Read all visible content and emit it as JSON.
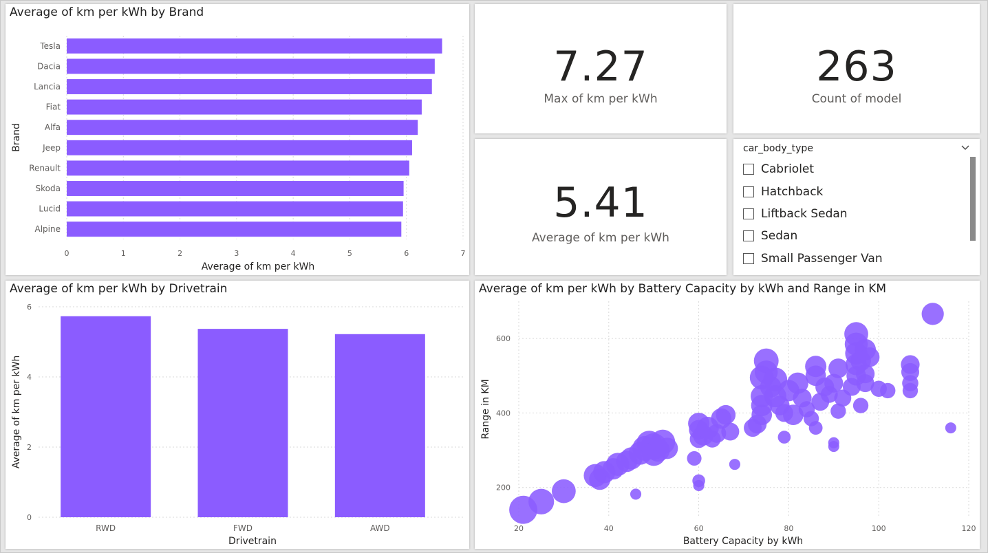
{
  "colors": {
    "bar": "#8b5cff",
    "bubble": "#8b5cff",
    "gridline": "#d9d9d9",
    "axis_text": "#605e5c"
  },
  "brand_chart": {
    "title": "Average of km per kWh by Brand",
    "chart_data": {
      "type": "bar",
      "orientation": "horizontal",
      "categories": [
        "Tesla",
        "Dacia",
        "Lancia",
        "Fiat",
        "Alfa",
        "Jeep",
        "Renault",
        "Skoda",
        "Lucid",
        "Alpine"
      ],
      "values": [
        6.63,
        6.5,
        6.45,
        6.27,
        6.2,
        6.1,
        6.05,
        5.95,
        5.94,
        5.91
      ],
      "xlabel": "Average of km per kWh",
      "ylabel": "Brand",
      "xlim": [
        0,
        7
      ],
      "xticks": [
        "0",
        "1",
        "2",
        "3",
        "4",
        "5",
        "6",
        "7"
      ],
      "grid": true
    }
  },
  "kpi_max": {
    "value": "7.27",
    "label": "Max of km per kWh"
  },
  "kpi_count": {
    "value": "263",
    "label": "Count of model"
  },
  "kpi_avg": {
    "value": "5.41",
    "label": "Average of km per kWh"
  },
  "slicer": {
    "title": "car_body_type",
    "items": [
      "Cabriolet",
      "Hatchback",
      "Liftback Sedan",
      "Sedan",
      "Small Passenger Van"
    ]
  },
  "drivetrain_chart": {
    "title": "Average of km per kWh by Drivetrain",
    "chart_data": {
      "type": "bar",
      "categories": [
        "RWD",
        "FWD",
        "AWD"
      ],
      "values": [
        5.73,
        5.37,
        5.22
      ],
      "xlabel": "Drivetrain",
      "ylabel": "Average of km per kWh",
      "ylim": [
        0,
        6
      ],
      "yticks": [
        "0",
        "2",
        "4",
        "6"
      ],
      "grid": true
    }
  },
  "scatter_chart": {
    "title": "Average of km per kWh by Battery Capacity by kWh and Range in KM",
    "chart_data": {
      "type": "scatter",
      "xlabel": "Battery Capacity by kWh",
      "ylabel": "Range in KM",
      "xlim": [
        20,
        120
      ],
      "ylim": [
        120,
        700
      ],
      "xticks": [
        "20",
        "40",
        "60",
        "80",
        "100",
        "120"
      ],
      "yticks": [
        "200",
        "400",
        "600"
      ],
      "grid": true,
      "points": [
        {
          "x": 21,
          "y": 140,
          "s": 6.8
        },
        {
          "x": 25,
          "y": 162,
          "s": 6.5
        },
        {
          "x": 30,
          "y": 190,
          "s": 6.3
        },
        {
          "x": 37,
          "y": 232,
          "s": 6.2
        },
        {
          "x": 38,
          "y": 222,
          "s": 6.0
        },
        {
          "x": 39,
          "y": 241,
          "s": 6.1
        },
        {
          "x": 41,
          "y": 250,
          "s": 6.0
        },
        {
          "x": 42,
          "y": 262,
          "s": 6.2
        },
        {
          "x": 44,
          "y": 270,
          "s": 6.0
        },
        {
          "x": 45,
          "y": 278,
          "s": 6.1
        },
        {
          "x": 46,
          "y": 182,
          "s": 4.8
        },
        {
          "x": 47,
          "y": 292,
          "s": 6.2
        },
        {
          "x": 48,
          "y": 305,
          "s": 6.4
        },
        {
          "x": 49,
          "y": 318,
          "s": 6.5
        },
        {
          "x": 50,
          "y": 310,
          "s": 6.6
        },
        {
          "x": 50,
          "y": 290,
          "s": 6.3
        },
        {
          "x": 51,
          "y": 300,
          "s": 6.2
        },
        {
          "x": 52,
          "y": 322,
          "s": 6.4
        },
        {
          "x": 53,
          "y": 305,
          "s": 6.0
        },
        {
          "x": 59,
          "y": 278,
          "s": 5.2
        },
        {
          "x": 60,
          "y": 218,
          "s": 5.0
        },
        {
          "x": 60,
          "y": 205,
          "s": 4.8
        },
        {
          "x": 60,
          "y": 330,
          "s": 5.6
        },
        {
          "x": 60,
          "y": 355,
          "s": 5.8
        },
        {
          "x": 60,
          "y": 372,
          "s": 6.0
        },
        {
          "x": 61,
          "y": 340,
          "s": 5.9
        },
        {
          "x": 62,
          "y": 360,
          "s": 6.1
        },
        {
          "x": 63,
          "y": 330,
          "s": 5.5
        },
        {
          "x": 64,
          "y": 345,
          "s": 5.7
        },
        {
          "x": 65,
          "y": 385,
          "s": 5.9
        },
        {
          "x": 66,
          "y": 395,
          "s": 5.8
        },
        {
          "x": 67,
          "y": 350,
          "s": 5.6
        },
        {
          "x": 68,
          "y": 262,
          "s": 4.8
        },
        {
          "x": 72,
          "y": 360,
          "s": 5.6
        },
        {
          "x": 73,
          "y": 370,
          "s": 5.7
        },
        {
          "x": 74,
          "y": 395,
          "s": 5.9
        },
        {
          "x": 74,
          "y": 420,
          "s": 6.0
        },
        {
          "x": 74,
          "y": 445,
          "s": 6.1
        },
        {
          "x": 74,
          "y": 495,
          "s": 6.3
        },
        {
          "x": 75,
          "y": 540,
          "s": 6.4
        },
        {
          "x": 75,
          "y": 510,
          "s": 6.2
        },
        {
          "x": 76,
          "y": 470,
          "s": 6.0
        },
        {
          "x": 77,
          "y": 445,
          "s": 6.1
        },
        {
          "x": 77,
          "y": 490,
          "s": 6.3
        },
        {
          "x": 78,
          "y": 420,
          "s": 5.8
        },
        {
          "x": 79,
          "y": 400,
          "s": 5.6
        },
        {
          "x": 79,
          "y": 335,
          "s": 5.0
        },
        {
          "x": 80,
          "y": 460,
          "s": 6.0
        },
        {
          "x": 81,
          "y": 395,
          "s": 5.9
        },
        {
          "x": 82,
          "y": 480,
          "s": 6.0
        },
        {
          "x": 83,
          "y": 440,
          "s": 5.7
        },
        {
          "x": 84,
          "y": 410,
          "s": 5.4
        },
        {
          "x": 85,
          "y": 385,
          "s": 5.3
        },
        {
          "x": 86,
          "y": 360,
          "s": 5.1
        },
        {
          "x": 86,
          "y": 500,
          "s": 5.9
        },
        {
          "x": 86,
          "y": 525,
          "s": 6.0
        },
        {
          "x": 87,
          "y": 430,
          "s": 5.6
        },
        {
          "x": 88,
          "y": 470,
          "s": 5.7
        },
        {
          "x": 89,
          "y": 450,
          "s": 5.5
        },
        {
          "x": 90,
          "y": 320,
          "s": 4.8
        },
        {
          "x": 90,
          "y": 310,
          "s": 4.6
        },
        {
          "x": 90,
          "y": 480,
          "s": 5.7
        },
        {
          "x": 91,
          "y": 520,
          "s": 5.8
        },
        {
          "x": 91,
          "y": 405,
          "s": 5.3
        },
        {
          "x": 92,
          "y": 440,
          "s": 5.5
        },
        {
          "x": 94,
          "y": 470,
          "s": 5.6
        },
        {
          "x": 95,
          "y": 500,
          "s": 5.8
        },
        {
          "x": 95,
          "y": 530,
          "s": 6.0
        },
        {
          "x": 95,
          "y": 560,
          "s": 6.1
        },
        {
          "x": 95,
          "y": 585,
          "s": 6.2
        },
        {
          "x": 95,
          "y": 612,
          "s": 6.3
        },
        {
          "x": 96,
          "y": 540,
          "s": 5.9
        },
        {
          "x": 96,
          "y": 420,
          "s": 5.3
        },
        {
          "x": 97,
          "y": 570,
          "s": 6.0
        },
        {
          "x": 97,
          "y": 505,
          "s": 5.7
        },
        {
          "x": 97,
          "y": 480,
          "s": 5.6
        },
        {
          "x": 98,
          "y": 550,
          "s": 5.8
        },
        {
          "x": 100,
          "y": 465,
          "s": 5.4
        },
        {
          "x": 102,
          "y": 460,
          "s": 5.3
        },
        {
          "x": 107,
          "y": 460,
          "s": 5.3
        },
        {
          "x": 107,
          "y": 480,
          "s": 5.4
        },
        {
          "x": 107,
          "y": 510,
          "s": 5.6
        },
        {
          "x": 107,
          "y": 530,
          "s": 5.7
        },
        {
          "x": 112,
          "y": 666,
          "s": 6.1
        },
        {
          "x": 116,
          "y": 360,
          "s": 4.6
        }
      ]
    }
  }
}
